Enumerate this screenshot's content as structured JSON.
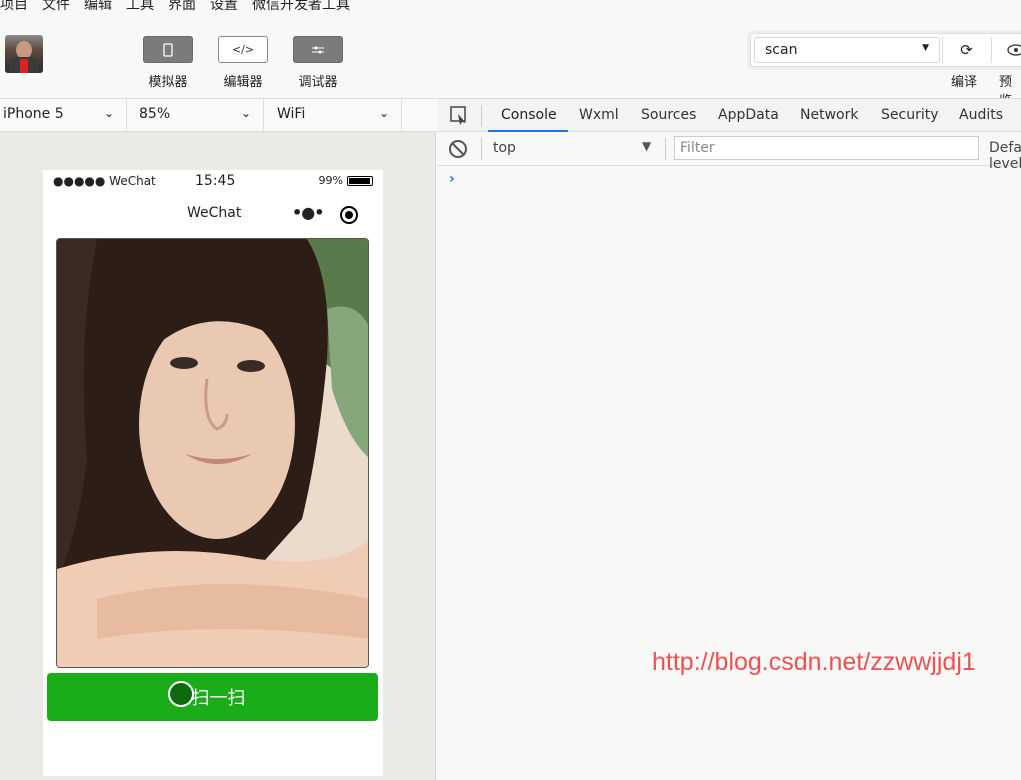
{
  "menu": [
    "项目",
    "文件",
    "编辑",
    "工具",
    "界面",
    "设置",
    "微信开发者工具"
  ],
  "toolbar": {
    "simulator_label": "模拟器",
    "editor_label": "编辑器",
    "debugger_label": "调试器",
    "editor_icon": "</>",
    "compile_mode": "scan",
    "compile_label": "编译",
    "preview_label": "预览"
  },
  "device": {
    "model": "iPhone 5",
    "zoom": "85%",
    "network": "WiFi"
  },
  "phone": {
    "signal": "●●●●● WeChat",
    "time": "15:45",
    "battery": "99%",
    "nav_title": "WeChat",
    "scan_button": "扫一扫"
  },
  "devtools": {
    "tabs": [
      "Console",
      "Wxml",
      "Sources",
      "AppData",
      "Network",
      "Security",
      "Audits"
    ],
    "active_tab": "Console",
    "context": "top",
    "filter_placeholder": "Filter",
    "levels": "Default levels",
    "prompt": "›"
  },
  "watermark": "http://blog.csdn.net/zzwwjjdj1",
  "colors": {
    "accent": "#1aad19",
    "tab_underline": "#1a73e8",
    "watermark": "#f05050"
  }
}
